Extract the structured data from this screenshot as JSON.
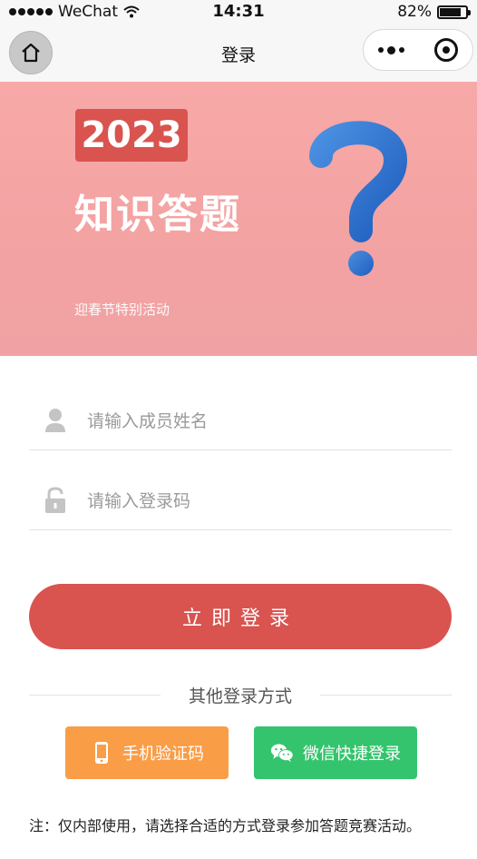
{
  "status_bar": {
    "carrier": "WeChat",
    "time": "14:31",
    "battery_percent": "82%",
    "battery_level": 0.82
  },
  "nav": {
    "title": "登录"
  },
  "banner": {
    "year": "2023",
    "title": "知识答题",
    "subtitle": "迎春节特别活动"
  },
  "form": {
    "name_placeholder": "请输入成员姓名",
    "code_placeholder": "请输入登录码",
    "login_label": "立即登录"
  },
  "other_login": {
    "heading": "其他登录方式",
    "phone_label": "手机验证码",
    "wechat_label": "微信快捷登录"
  },
  "note": "注：仅内部使用，请选择合适的方式登录参加答题竞赛活动。",
  "colors": {
    "primary": "#d9534f",
    "phone": "#fa9d47",
    "wechat": "#34c46d",
    "banner": "#f4a3a3"
  }
}
